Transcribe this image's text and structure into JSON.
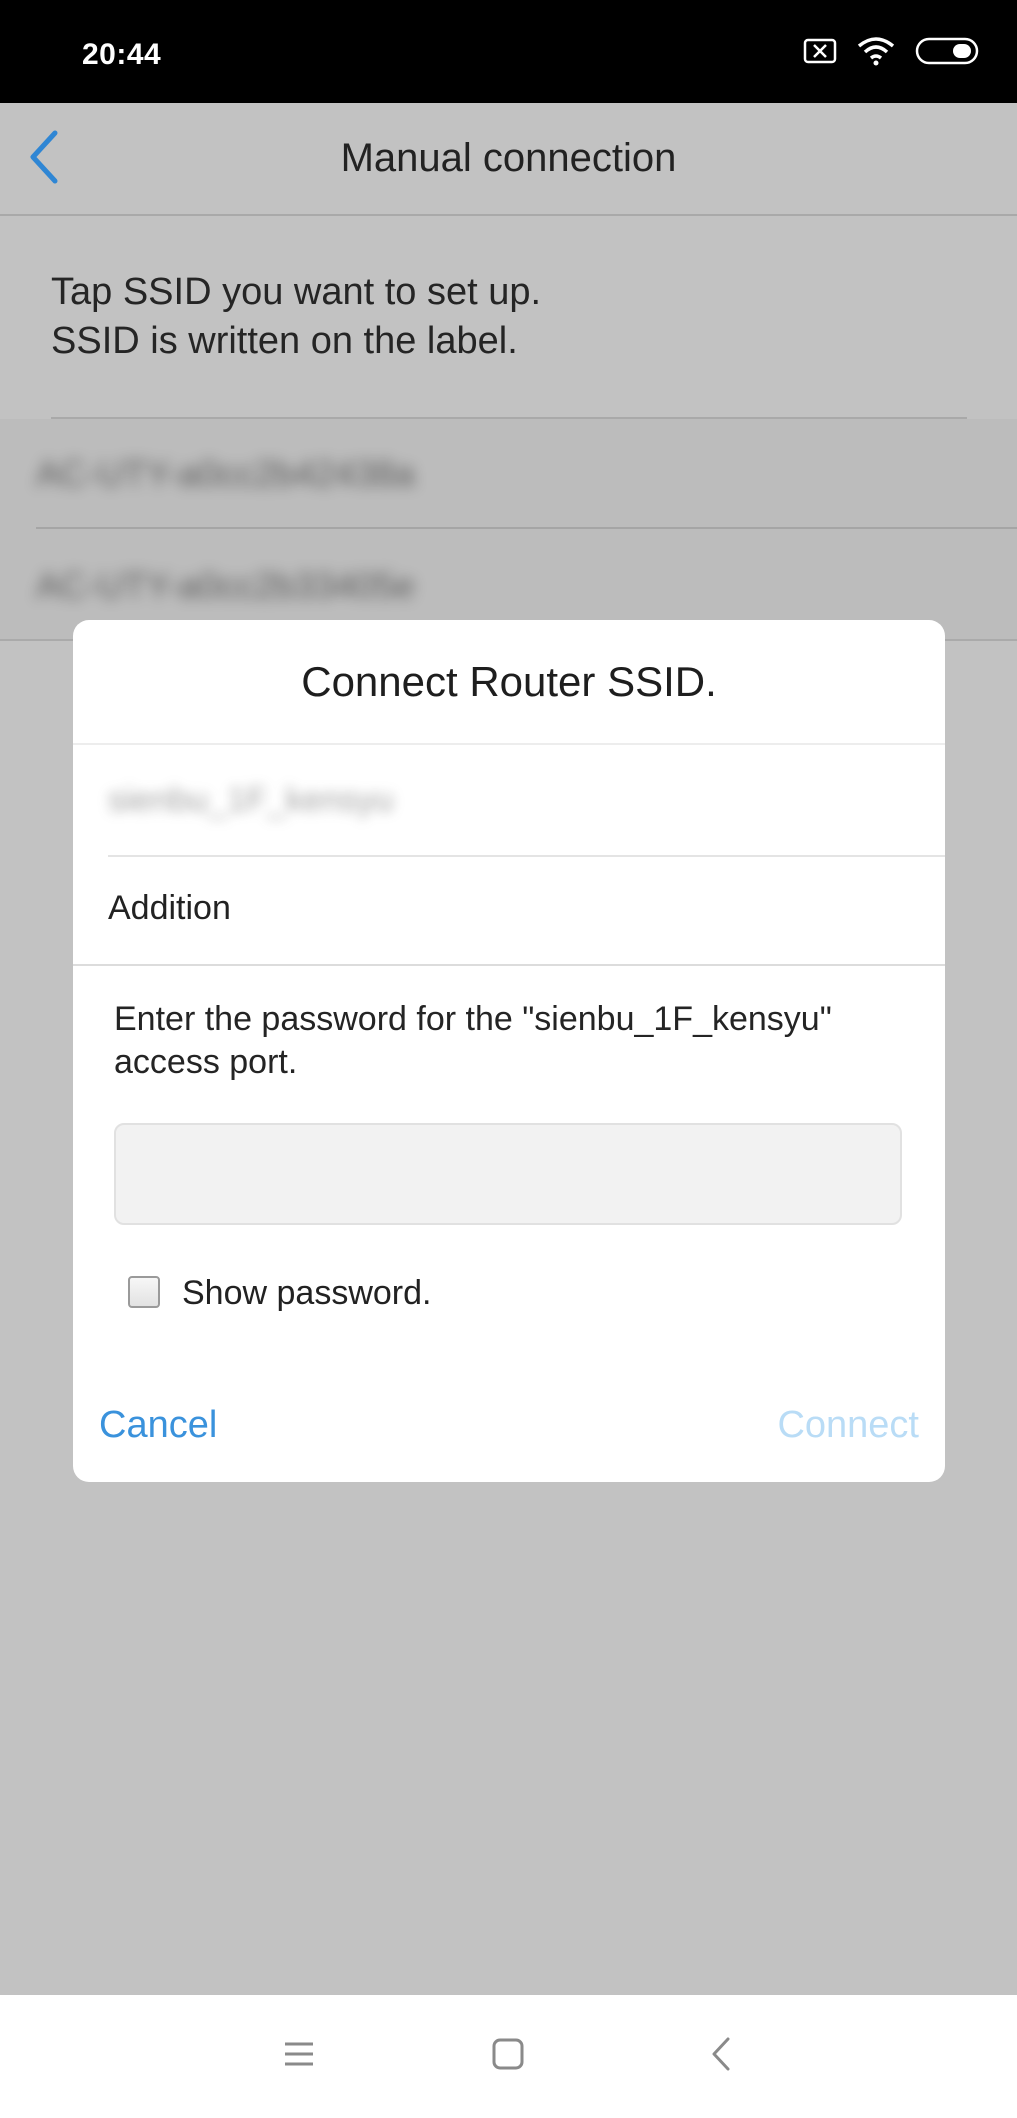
{
  "status_bar": {
    "time": "20:44",
    "icons": [
      "notification-dismiss-icon",
      "wifi-icon",
      "battery-icon"
    ]
  },
  "app_bar": {
    "title": "Manual connection",
    "back_icon": "chevron-left-icon"
  },
  "instructions": {
    "line1": "Tap SSID you want to set up.",
    "line2": "SSID is written on the label."
  },
  "ssid_list": {
    "items": [
      {
        "label": "AC-UTY-a0cc2b42438a"
      },
      {
        "label": "AC-UTY-a0cc2b33405e"
      }
    ]
  },
  "dialog": {
    "title": "Connect Router SSID.",
    "ssid_option": "sienbu_1F_kensyu",
    "addition_label": "Addition",
    "password_prompt": "Enter the password for the \"sienbu_1F_kensyu\" access port.",
    "password_value": "",
    "password_placeholder": "",
    "show_password_label": "Show password.",
    "show_password_checked": false,
    "cancel_label": "Cancel",
    "connect_label": "Connect"
  },
  "nav_bar": {
    "icons": [
      "menu-icon",
      "home-icon",
      "back-icon"
    ]
  },
  "colors": {
    "accent": "#3a92dc",
    "accent_disabled": "#b9dcf6",
    "scrim_background": "#c2c2c2",
    "status_bar": "#000000"
  }
}
